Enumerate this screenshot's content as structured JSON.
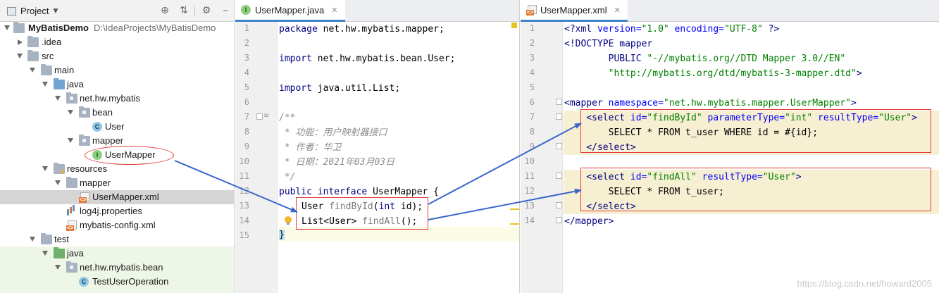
{
  "project_panel": {
    "title": "Project",
    "tree": [
      {
        "label": "MyBatisDemo",
        "path": "D:\\IdeaProjects\\MyBatisDemo"
      },
      {
        "label": ".idea"
      },
      {
        "label": "src"
      },
      {
        "label": "main"
      },
      {
        "label": "java"
      },
      {
        "label": "net.hw.mybatis"
      },
      {
        "label": "bean"
      },
      {
        "label": "User"
      },
      {
        "label": "mapper"
      },
      {
        "label": "UserMapper"
      },
      {
        "label": "resources"
      },
      {
        "label": "mapper"
      },
      {
        "label": "UserMapper.xml"
      },
      {
        "label": "log4j.properties"
      },
      {
        "label": "mybatis-config.xml"
      },
      {
        "label": "test"
      },
      {
        "label": "java"
      },
      {
        "label": "net.hw.mybatis.bean"
      },
      {
        "label": "TestUserOperation"
      }
    ]
  },
  "java_editor": {
    "tab_label": "UserMapper.java",
    "line_numbers": [
      "1",
      "2",
      "3",
      "4",
      "5",
      "6",
      "7",
      "8",
      "9",
      "10",
      "11",
      "12",
      "13",
      "14",
      "15"
    ],
    "lines": {
      "l1_kw": "package",
      "l1_rest": " net.hw.mybatis.mapper;",
      "l3_kw": "import",
      "l3_rest": " net.hw.mybatis.bean.User;",
      "l5_kw": "import",
      "l5_rest": " java.util.List;",
      "l7": "/**",
      "l8": " * 功能：用户映射器接口",
      "l9": " * 作者：华卫",
      "l10": " * 日期：2021年03月03日",
      "l11": " */",
      "l12_kw1": "public",
      "l12_kw2": "interface",
      "l12_rest": " UserMapper {",
      "l13_type": "User ",
      "l13_name": "findById",
      "l13_paren": "(",
      "l13_int": "int",
      "l13_rest": " id);",
      "l14_type": "List<User> ",
      "l14_name": "findAll",
      "l14_rest": "();",
      "l15": "}"
    }
  },
  "xml_editor": {
    "tab_label": "UserMapper.xml",
    "line_numbers": [
      "1",
      "2",
      "3",
      "4",
      "5",
      "6",
      "7",
      "8",
      "9",
      "10",
      "11",
      "12",
      "13",
      "14"
    ],
    "lines": {
      "l1_a": "<?xml ",
      "l1_b": "version=",
      "l1_c": "\"1.0\"",
      "l1_d": " encoding=",
      "l1_e": "\"UTF-8\"",
      "l1_f": " ?>",
      "l2": "<!DOCTYPE mapper",
      "l3_a": "        PUBLIC ",
      "l3_b": "\"-//mybatis.org//DTD Mapper 3.0//EN\"",
      "l4_a": "        ",
      "l4_b": "\"http://mybatis.org/dtd/mybatis-3-mapper.dtd\"",
      "l4_c": ">",
      "l6_a": "<mapper ",
      "l6_b": "namespace=",
      "l6_c": "\"net.hw.mybatis.mapper.UserMapper\"",
      "l6_d": ">",
      "l7_a": "    <select ",
      "l7_b": "id=",
      "l7_c": "\"findById\"",
      "l7_d": " parameterType=",
      "l7_e": "\"int\"",
      "l7_f": " resultType=",
      "l7_g": "\"User\"",
      "l7_h": ">",
      "l8": "        SELECT * FROM t_user WHERE id = #{id};",
      "l9": "    </select>",
      "l11_a": "    <select ",
      "l11_b": "id=",
      "l11_c": "\"findAll\"",
      "l11_d": " resultType=",
      "l11_e": "\"User\"",
      "l11_f": ">",
      "l12": "        SELECT * FROM t_user;",
      "l13": "    </select>",
      "l14": "</mapper>"
    }
  },
  "watermark": "https://blog.csdn.net/howard2005",
  "colors": {
    "annotation_red": "#e43a3a",
    "arrow_blue": "#3a66cc",
    "tab_underline": "#4083c9",
    "selected_row": "#d5d5d5",
    "test_row": "#eef7e7",
    "xml_highlight": "#f7efd2"
  }
}
